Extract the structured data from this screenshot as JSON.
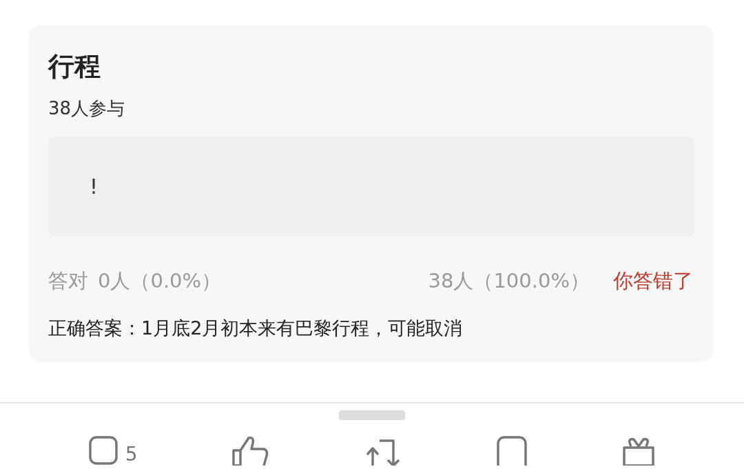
{
  "card": {
    "title": "行程",
    "participants": "38人参与",
    "options": [
      {
        "text": "!"
      }
    ],
    "stats": {
      "correct_label": "答对",
      "correct_count": "0人（0.0%）",
      "wrong_count": "38人（100.0%）",
      "result": "你答错了"
    },
    "answer": "正确答案：1月底2月初本来有巴黎行程，可能取消"
  },
  "actions": [
    {
      "kind": "comment",
      "count": "5"
    },
    {
      "kind": "like"
    },
    {
      "kind": "repost"
    },
    {
      "kind": "bookmark"
    },
    {
      "kind": "gift"
    }
  ]
}
